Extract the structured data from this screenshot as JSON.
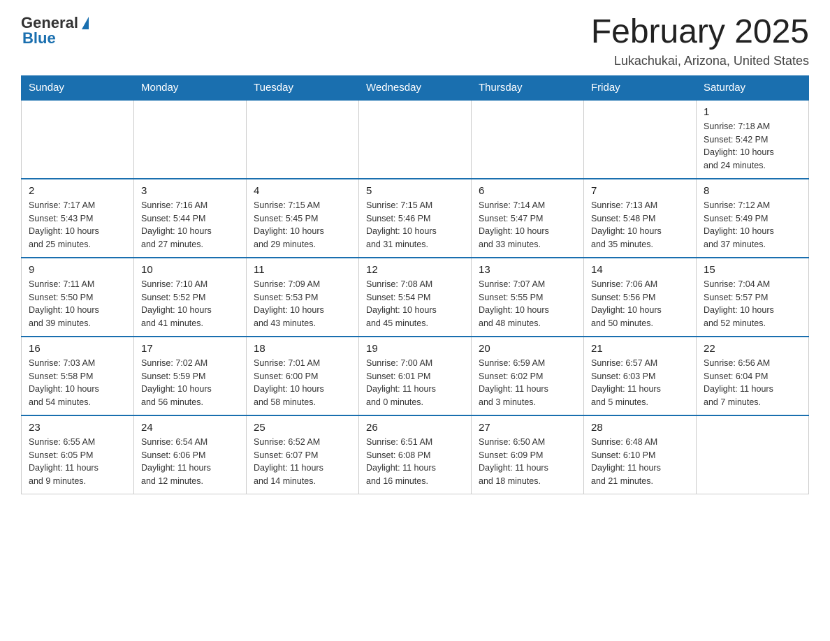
{
  "header": {
    "logo_general": "General",
    "logo_blue": "Blue",
    "month_title": "February 2025",
    "location": "Lukachukai, Arizona, United States"
  },
  "days_of_week": [
    "Sunday",
    "Monday",
    "Tuesday",
    "Wednesday",
    "Thursday",
    "Friday",
    "Saturday"
  ],
  "weeks": [
    [
      {
        "day": "",
        "info": ""
      },
      {
        "day": "",
        "info": ""
      },
      {
        "day": "",
        "info": ""
      },
      {
        "day": "",
        "info": ""
      },
      {
        "day": "",
        "info": ""
      },
      {
        "day": "",
        "info": ""
      },
      {
        "day": "1",
        "info": "Sunrise: 7:18 AM\nSunset: 5:42 PM\nDaylight: 10 hours\nand 24 minutes."
      }
    ],
    [
      {
        "day": "2",
        "info": "Sunrise: 7:17 AM\nSunset: 5:43 PM\nDaylight: 10 hours\nand 25 minutes."
      },
      {
        "day": "3",
        "info": "Sunrise: 7:16 AM\nSunset: 5:44 PM\nDaylight: 10 hours\nand 27 minutes."
      },
      {
        "day": "4",
        "info": "Sunrise: 7:15 AM\nSunset: 5:45 PM\nDaylight: 10 hours\nand 29 minutes."
      },
      {
        "day": "5",
        "info": "Sunrise: 7:15 AM\nSunset: 5:46 PM\nDaylight: 10 hours\nand 31 minutes."
      },
      {
        "day": "6",
        "info": "Sunrise: 7:14 AM\nSunset: 5:47 PM\nDaylight: 10 hours\nand 33 minutes."
      },
      {
        "day": "7",
        "info": "Sunrise: 7:13 AM\nSunset: 5:48 PM\nDaylight: 10 hours\nand 35 minutes."
      },
      {
        "day": "8",
        "info": "Sunrise: 7:12 AM\nSunset: 5:49 PM\nDaylight: 10 hours\nand 37 minutes."
      }
    ],
    [
      {
        "day": "9",
        "info": "Sunrise: 7:11 AM\nSunset: 5:50 PM\nDaylight: 10 hours\nand 39 minutes."
      },
      {
        "day": "10",
        "info": "Sunrise: 7:10 AM\nSunset: 5:52 PM\nDaylight: 10 hours\nand 41 minutes."
      },
      {
        "day": "11",
        "info": "Sunrise: 7:09 AM\nSunset: 5:53 PM\nDaylight: 10 hours\nand 43 minutes."
      },
      {
        "day": "12",
        "info": "Sunrise: 7:08 AM\nSunset: 5:54 PM\nDaylight: 10 hours\nand 45 minutes."
      },
      {
        "day": "13",
        "info": "Sunrise: 7:07 AM\nSunset: 5:55 PM\nDaylight: 10 hours\nand 48 minutes."
      },
      {
        "day": "14",
        "info": "Sunrise: 7:06 AM\nSunset: 5:56 PM\nDaylight: 10 hours\nand 50 minutes."
      },
      {
        "day": "15",
        "info": "Sunrise: 7:04 AM\nSunset: 5:57 PM\nDaylight: 10 hours\nand 52 minutes."
      }
    ],
    [
      {
        "day": "16",
        "info": "Sunrise: 7:03 AM\nSunset: 5:58 PM\nDaylight: 10 hours\nand 54 minutes."
      },
      {
        "day": "17",
        "info": "Sunrise: 7:02 AM\nSunset: 5:59 PM\nDaylight: 10 hours\nand 56 minutes."
      },
      {
        "day": "18",
        "info": "Sunrise: 7:01 AM\nSunset: 6:00 PM\nDaylight: 10 hours\nand 58 minutes."
      },
      {
        "day": "19",
        "info": "Sunrise: 7:00 AM\nSunset: 6:01 PM\nDaylight: 11 hours\nand 0 minutes."
      },
      {
        "day": "20",
        "info": "Sunrise: 6:59 AM\nSunset: 6:02 PM\nDaylight: 11 hours\nand 3 minutes."
      },
      {
        "day": "21",
        "info": "Sunrise: 6:57 AM\nSunset: 6:03 PM\nDaylight: 11 hours\nand 5 minutes."
      },
      {
        "day": "22",
        "info": "Sunrise: 6:56 AM\nSunset: 6:04 PM\nDaylight: 11 hours\nand 7 minutes."
      }
    ],
    [
      {
        "day": "23",
        "info": "Sunrise: 6:55 AM\nSunset: 6:05 PM\nDaylight: 11 hours\nand 9 minutes."
      },
      {
        "day": "24",
        "info": "Sunrise: 6:54 AM\nSunset: 6:06 PM\nDaylight: 11 hours\nand 12 minutes."
      },
      {
        "day": "25",
        "info": "Sunrise: 6:52 AM\nSunset: 6:07 PM\nDaylight: 11 hours\nand 14 minutes."
      },
      {
        "day": "26",
        "info": "Sunrise: 6:51 AM\nSunset: 6:08 PM\nDaylight: 11 hours\nand 16 minutes."
      },
      {
        "day": "27",
        "info": "Sunrise: 6:50 AM\nSunset: 6:09 PM\nDaylight: 11 hours\nand 18 minutes."
      },
      {
        "day": "28",
        "info": "Sunrise: 6:48 AM\nSunset: 6:10 PM\nDaylight: 11 hours\nand 21 minutes."
      },
      {
        "day": "",
        "info": ""
      }
    ]
  ]
}
